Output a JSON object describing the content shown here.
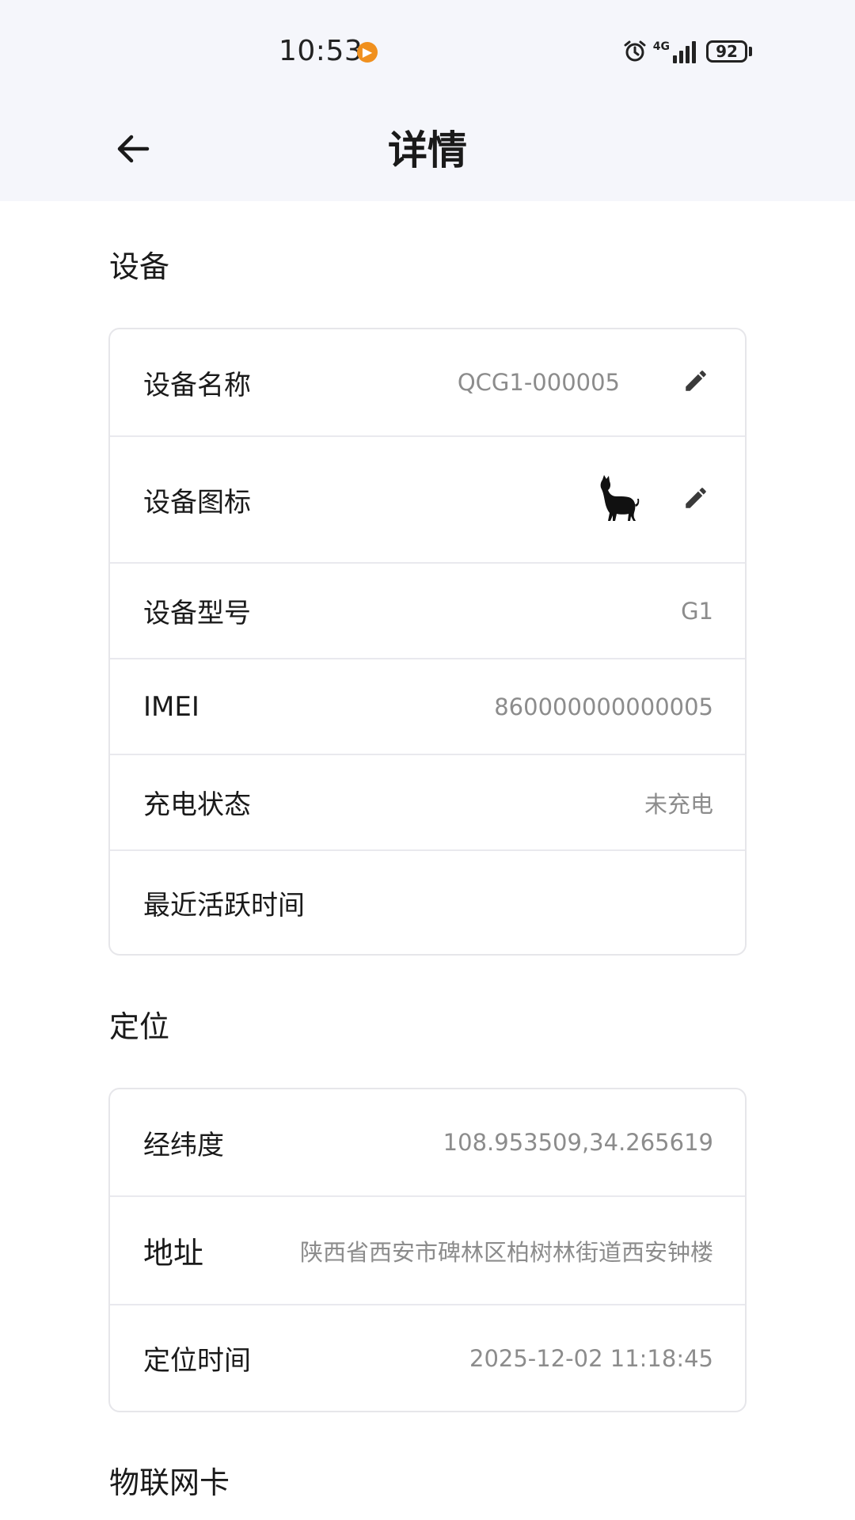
{
  "status_bar": {
    "time": "10:53",
    "network": "4G",
    "battery": "92"
  },
  "header": {
    "title": "详情",
    "back_icon": "arrow-left-icon"
  },
  "device_section": {
    "title": "设备",
    "rows": {
      "name": {
        "label": "设备名称",
        "value": "QCG1-000005"
      },
      "icon": {
        "label": "设备图标",
        "icon": "cat-icon"
      },
      "model": {
        "label": "设备型号",
        "value": "G1"
      },
      "imei": {
        "label": "IMEI",
        "value": "860000000000005"
      },
      "charging": {
        "label": "充电状态",
        "value": "未充电"
      },
      "last_active": {
        "label": "最近活跃时间",
        "value": ""
      }
    }
  },
  "location_section": {
    "title": "定位",
    "rows": {
      "coords": {
        "label": "经纬度",
        "value": "108.953509,34.265619"
      },
      "address": {
        "label": "地址",
        "value": "陕西省西安市碑林区柏树林街道西安钟楼"
      },
      "time": {
        "label": "定位时间",
        "value": "2025-12-02 11:18:45"
      }
    }
  },
  "sim_section": {
    "title": "物联网卡"
  },
  "colors": {
    "header_bg": "#f5f6fb",
    "notification": "#f0901e",
    "value_text": "#8c8c8c",
    "border": "#e6e6ea"
  }
}
